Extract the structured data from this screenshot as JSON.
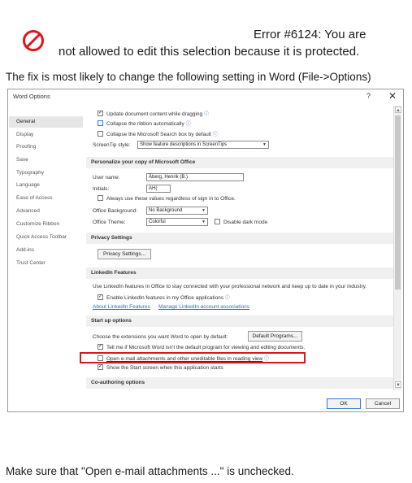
{
  "error": {
    "line1": "Error #6124: You are",
    "line2": "not allowed to edit this selection because it is protected.",
    "icon": "prohibited-icon",
    "icon_color": "#e0141e"
  },
  "fix_text": "The fix is most likely to change the following setting in Word (File->Options)",
  "bottom_text": "Make sure that \"Open e-mail attachments ...\" is unchecked.",
  "dialog": {
    "title": "Word Options",
    "help_label": "?",
    "close_label": "✕",
    "sidebar": [
      {
        "label": "General",
        "active": true
      },
      {
        "label": "Display"
      },
      {
        "label": "Proofing"
      },
      {
        "label": "Save"
      },
      {
        "label": "Typography"
      },
      {
        "label": "Language"
      },
      {
        "label": "Ease of Access"
      },
      {
        "label": "Advanced"
      },
      {
        "label": "Customize Ribbon"
      },
      {
        "label": "Quick Access Toolbar"
      },
      {
        "label": "Add-ins"
      },
      {
        "label": "Trust Center"
      }
    ],
    "ui_options": {
      "update_content": "Update document content while dragging",
      "collapse_ribbon": "Collapse the ribbon automatically",
      "collapse_search": "Collapse the Microsoft Search box by default",
      "screentip_label": "ScreenTip style:",
      "screentip_value": "Show feature descriptions in ScreenTips"
    },
    "personalize": {
      "header": "Personalize your copy of Microsoft Office",
      "username_label": "User name:",
      "username_value": "Åberg, Henrik (B.)",
      "initials_label": "Initials:",
      "initials_value": "AH(",
      "always_use": "Always use these values regardless of sign in to Office.",
      "background_label": "Office Background:",
      "background_value": "No Background",
      "theme_label": "Office Theme:",
      "theme_value": "Colorful",
      "disable_dark": "Disable dark mode"
    },
    "privacy": {
      "header": "Privacy Settings",
      "button": "Privacy Settings..."
    },
    "linkedin": {
      "header": "LinkedIn Features",
      "description": "Use LinkedIn features in Office to stay connected with your professional network and keep up to date in your industry.",
      "enable": "Enable LinkedIn features in my Office applications",
      "link_about": "About LinkedIn Features",
      "link_manage": "Manage LinkedIn account associations"
    },
    "startup": {
      "header": "Start up options",
      "choose_ext": "Choose the extensions you want Word to open by default:",
      "default_programs": "Default Programs...",
      "tell_me": "Tell me if Microsoft Word isn't the default program for viewing and editing documents.",
      "open_email": "Open e-mail attachments and other uneditable files in reading view",
      "show_start": "Show the Start screen when this application starts"
    },
    "coauthoring": {
      "header": "Co-authoring options"
    },
    "ok_label": "OK",
    "cancel_label": "Cancel"
  },
  "colors": {
    "highlight": "#e0141e",
    "link": "#2b6cc4"
  }
}
